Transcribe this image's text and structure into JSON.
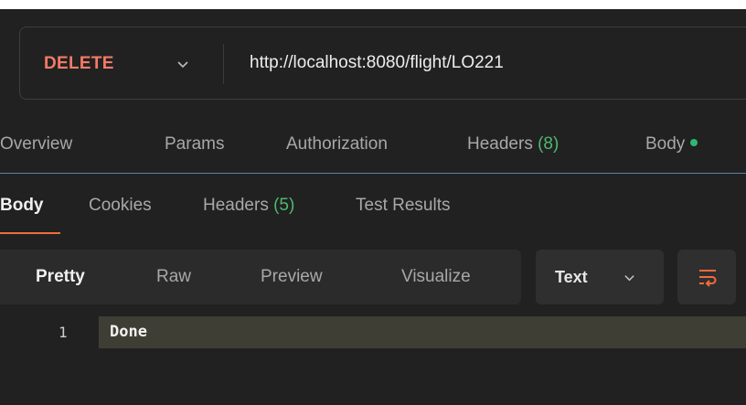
{
  "request": {
    "method": "DELETE",
    "url": "http://localhost:8080/flight/LO221"
  },
  "request_tabs": {
    "overview": "Overview",
    "params": "Params",
    "authorization": "Authorization",
    "headers_label": "Headers",
    "headers_count": "(8)",
    "body": "Body"
  },
  "response_tabs": {
    "body": "Body",
    "cookies": "Cookies",
    "headers_label": "Headers",
    "headers_count": "(5)",
    "test_results": "Test Results"
  },
  "view_modes": {
    "pretty": "Pretty",
    "raw": "Raw",
    "preview": "Preview",
    "visualize": "Visualize"
  },
  "format": {
    "selected": "Text"
  },
  "response_body": {
    "line_number": "1",
    "content": "Done"
  },
  "colors": {
    "method": "#f27b67",
    "count_green": "#4fb870",
    "active_tab_underline": "#f26b3a"
  },
  "icons": {
    "method_dropdown": "chevron-down-icon",
    "format_dropdown": "chevron-down-icon",
    "wrap": "wrap-lines-icon",
    "body_status": "dot-icon"
  }
}
